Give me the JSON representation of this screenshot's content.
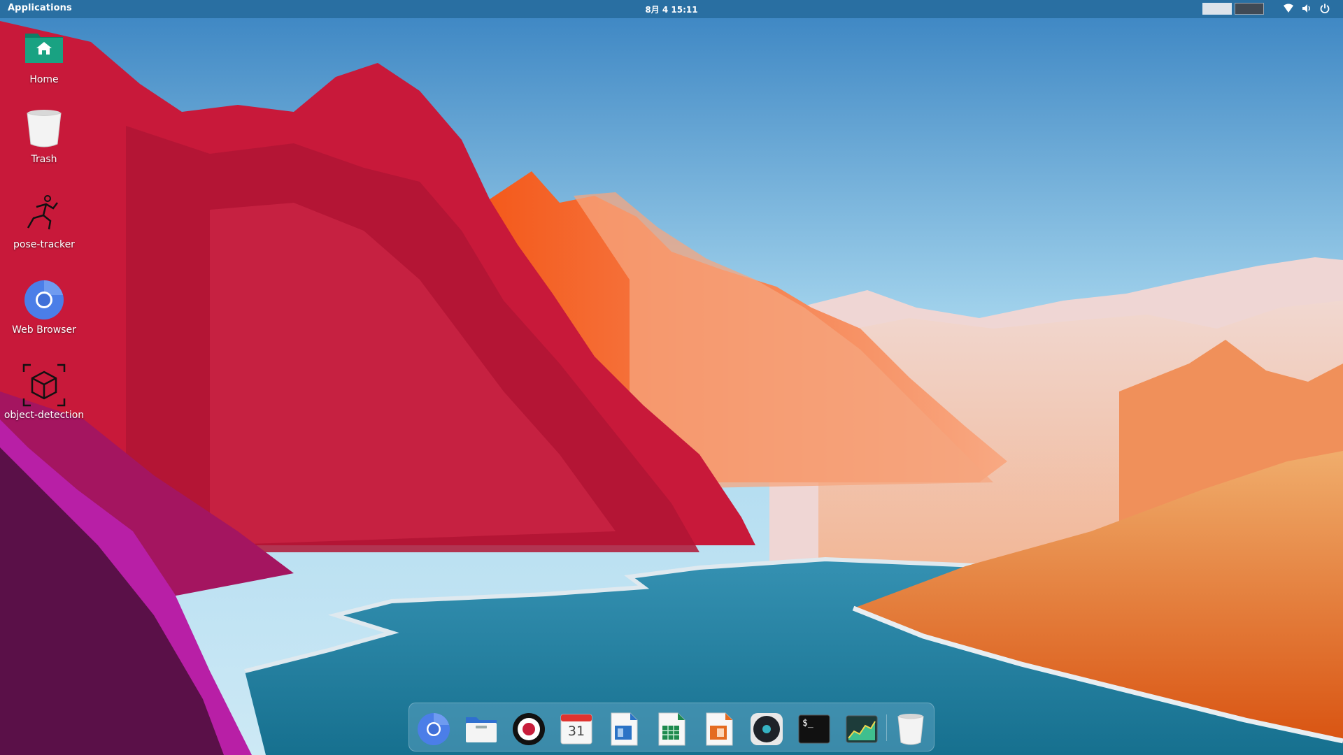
{
  "panel": {
    "apps_label": "Applications",
    "clock": "8月 4  15:11",
    "workspaces": [
      "Workspace 1",
      "Workspace 2"
    ],
    "tray_icons": [
      "network-icon",
      "volume-icon",
      "power-icon"
    ]
  },
  "desktop": {
    "icons": [
      {
        "label": "Home",
        "icon": "home-folder-icon"
      },
      {
        "label": "Trash",
        "icon": "trash-icon"
      },
      {
        "label": "pose-tracker",
        "icon": "running-figure-icon"
      },
      {
        "label": "Web Browser",
        "icon": "chromium-icon"
      },
      {
        "label": "object-detection",
        "icon": "cube-detection-icon"
      }
    ]
  },
  "dock": {
    "items": [
      {
        "icon": "chromium-icon"
      },
      {
        "icon": "files-icon"
      },
      {
        "icon": "screen-recorder-icon"
      },
      {
        "icon": "calendar-icon",
        "text": "31"
      },
      {
        "icon": "writer-icon"
      },
      {
        "icon": "spreadsheet-icon"
      },
      {
        "icon": "presentation-icon"
      },
      {
        "icon": "music-player-icon"
      },
      {
        "icon": "terminal-icon",
        "text": "$_"
      },
      {
        "icon": "system-monitor-icon"
      },
      {
        "icon": "trash-icon"
      }
    ]
  },
  "colors": {
    "panel_bg": "#286ea0",
    "sky_top": "#3b86c4",
    "water": "#1f7fa3",
    "mountain_red": "#c8102e",
    "mountain_orange": "#f26a2e",
    "dune": "#e8782e"
  }
}
